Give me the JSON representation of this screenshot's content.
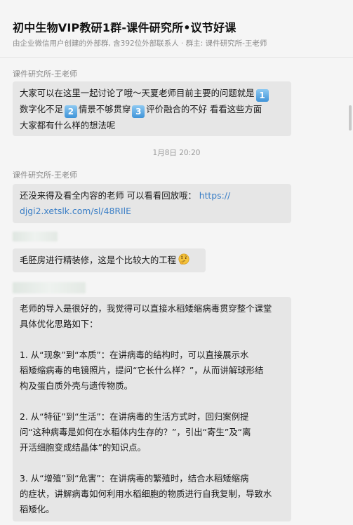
{
  "header": {
    "title": "初中生物VIP教研1群-课件研究所•议节好课",
    "subtitle": "由企业微信用户创建的外部群, 含392位外部联系人 · 群主: 课件研究所-王老师"
  },
  "messages": [
    {
      "sender": "课件研究所-王老师",
      "line1": "大家可以在这里一起讨论了哦～天夏老师目前主要的问题就是",
      "line2_a": "数字化不足",
      "line2_b": "情景不够贯穿",
      "line2_c": "评价融合的不好  看看这些方面",
      "line3": "大家都有什么样的想法呢",
      "badges": [
        "1",
        "2",
        "3"
      ]
    },
    {
      "timestamp": "1月8日 20:20"
    },
    {
      "sender": "课件研究所-王老师",
      "line1_a": "还没来得及看全内容的老师 可以看看回放哦：",
      "link_a": "https://",
      "link_b": "djgi2.xetslk.com/sl/48RIlE"
    },
    {
      "text": "毛胚房进行精装修，这是个比较大的工程",
      "emoji": "thinking-face"
    },
    {
      "p1_l1": "老师的导入是很好的，我觉得可以直接水稻矮缩病毒贯穿整个课堂",
      "p1_l2": "具体优化思路如下：",
      "p2_l1": "1. 从“现象”到“本质”：在讲病毒的结构时，可以直接展示水",
      "p2_l2": "稻矮缩病毒的电镜照片，提问“它长什么样？”，从而讲解球形结",
      "p2_l3": "构及蛋白质外壳与遗传物质。",
      "p3_l1": "2. 从“特征”到“生活”：在讲病毒的生活方式时，回归案例提",
      "p3_l2": "问“这种病毒是如何在水稻体内生存的？”，引出“寄生”及“离",
      "p3_l3": "开活细胞变成结晶体”的知识点。",
      "p4_l1": "3. 从“增殖”到“危害”：在讲病毒的繁殖时，结合水稻矮缩病",
      "p4_l2": "的症状，讲解病毒如何利用水稻细胞的物质进行自我复制，导致水",
      "p4_l3": "稻矮化。"
    }
  ]
}
